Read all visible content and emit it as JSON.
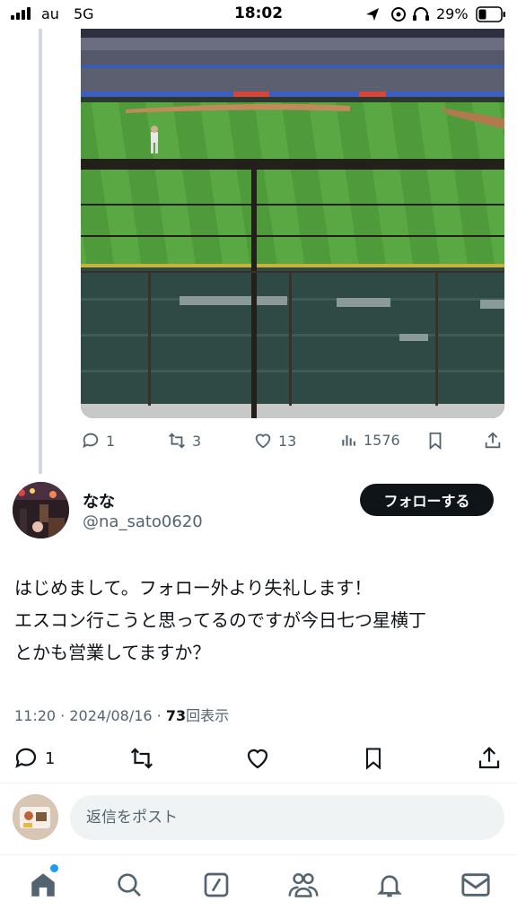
{
  "status_bar": {
    "carrier": "au",
    "network": "5G",
    "time": "18:02",
    "battery_percent": "29%"
  },
  "parent_tweet": {
    "image_description_icon": "baseball-field-photo",
    "actions": {
      "replies": "1",
      "retweets": "3",
      "likes": "13",
      "views": "1576"
    }
  },
  "tweet": {
    "display_name": "なな",
    "handle": "@na_sato0620",
    "follow_label": "フォローする",
    "text_lines": [
      "はじめまして。フォロー外より失礼します！",
      "エスコン行こうと思ってるのですが今日七つ星横丁",
      "とかも営業してますか？"
    ],
    "time": "11:20",
    "date": "2024/08/16",
    "views_count": "73",
    "views_label": "回表示",
    "reply_count": "1"
  },
  "reply_bar": {
    "placeholder": "返信をポスト"
  },
  "nav": {
    "items": [
      "home-icon",
      "search-icon",
      "grok-icon",
      "communities-icon",
      "notifications-icon",
      "messages-icon"
    ]
  },
  "colors": {
    "text_primary": "#0f1419",
    "text_secondary": "#536471",
    "accent": "#1d9bf0",
    "button_dark": "#0f1419"
  }
}
